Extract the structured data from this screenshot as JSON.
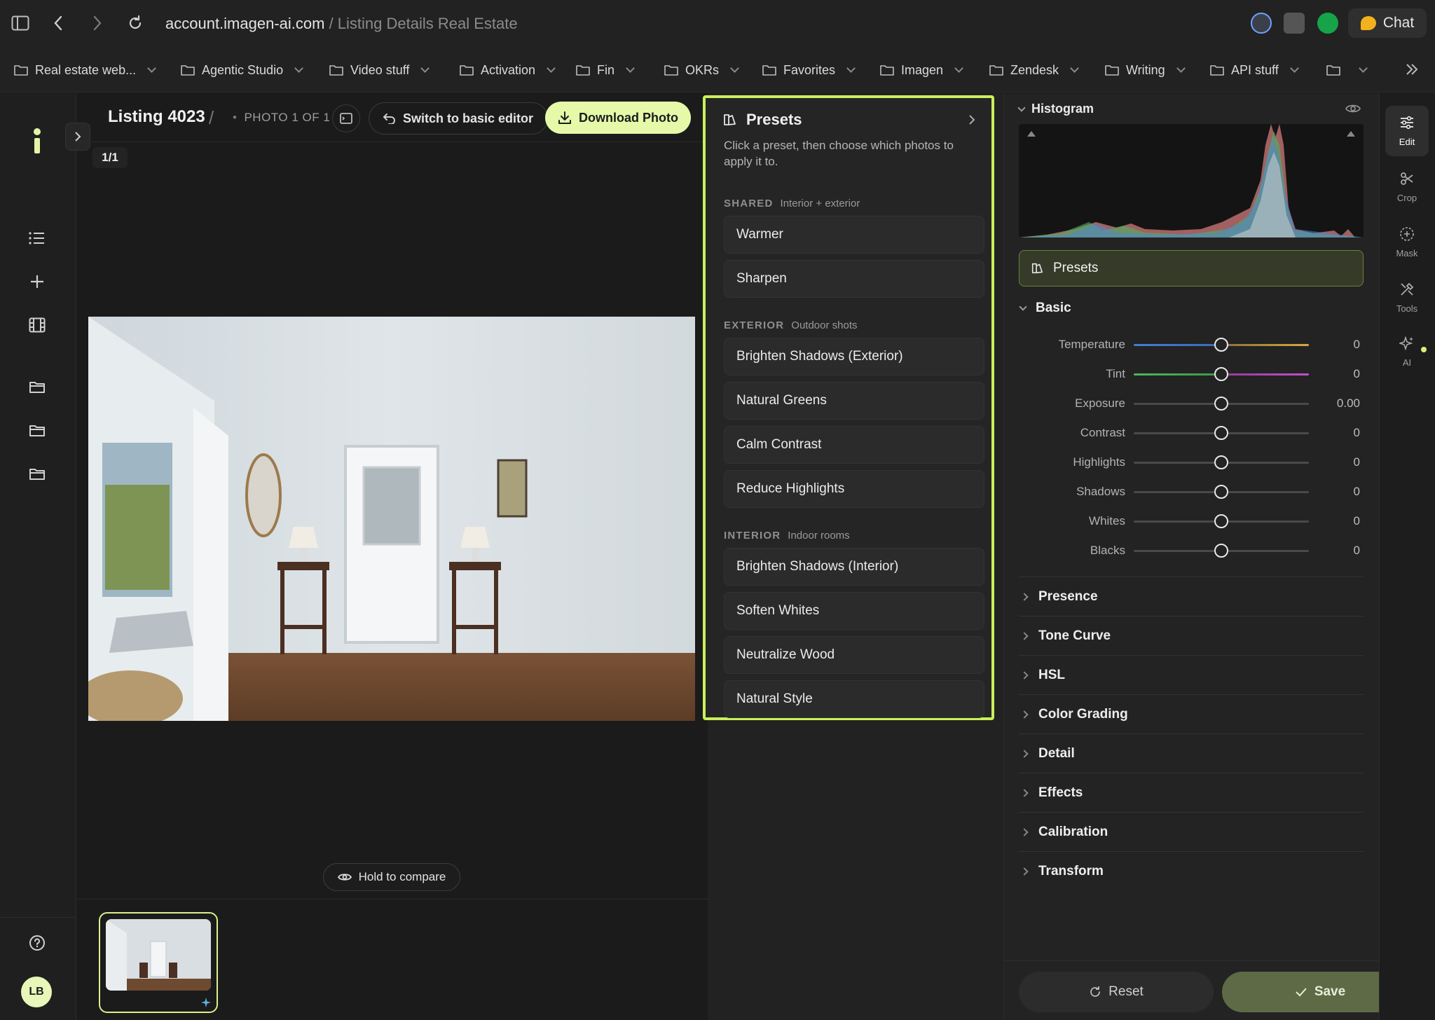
{
  "browser": {
    "url_host": "account.imagen-ai.com",
    "url_path": " / Listing Details Real Estate",
    "chat_label": "Chat",
    "bookmarks": [
      {
        "label": "Real estate web..."
      },
      {
        "label": "Agentic Studio"
      },
      {
        "label": "Video stuff"
      },
      {
        "label": "Activation"
      },
      {
        "label": "Fin"
      },
      {
        "label": "OKRs"
      },
      {
        "label": "Favorites"
      },
      {
        "label": "Imagen"
      },
      {
        "label": "Zendesk"
      },
      {
        "label": "Writing"
      },
      {
        "label": "API stuff"
      },
      {
        "label": ""
      }
    ]
  },
  "sidebar": {
    "avatar_initials": "LB",
    "icons": [
      "logo-icon",
      "list-icon",
      "plus-icon",
      "film-icon",
      "folder-icon",
      "folder-icon",
      "folder-icon",
      "help-icon"
    ]
  },
  "editor": {
    "title": "Listing 4023",
    "separator": "/",
    "photo_counter_text": "PHOTO 1 OF 1",
    "switch_label": "Switch to basic editor",
    "download_label": "Download Photo",
    "page_counter": "1/1",
    "compare_label": "Hold to compare"
  },
  "presets": {
    "title": "Presets",
    "description": "Click a preset, then choose which photos to apply it to.",
    "sections": [
      {
        "name": "SHARED",
        "subtitle": "Interior + exterior",
        "items": [
          "Warmer",
          "Sharpen"
        ]
      },
      {
        "name": "EXTERIOR",
        "subtitle": "Outdoor shots",
        "items": [
          "Brighten Shadows (Exterior)",
          "Natural Greens",
          "Calm Contrast",
          "Reduce Highlights"
        ]
      },
      {
        "name": "INTERIOR",
        "subtitle": "Indoor rooms",
        "items": [
          "Brighten Shadows (Interior)",
          "Soften Whites",
          "Neutralize Wood",
          "Natural Style"
        ]
      }
    ]
  },
  "edit_panel": {
    "histogram_title": "Histogram",
    "presets_button": "Presets",
    "basic_title": "Basic",
    "sliders": [
      {
        "label": "Temperature",
        "value": "0",
        "position": 0.5
      },
      {
        "label": "Tint",
        "value": "0",
        "position": 0.5
      },
      {
        "label": "Exposure",
        "value": "0.00",
        "position": 0.5
      },
      {
        "label": "Contrast",
        "value": "0",
        "position": 0.5
      },
      {
        "label": "Highlights",
        "value": "0",
        "position": 0.5
      },
      {
        "label": "Shadows",
        "value": "0",
        "position": 0.5
      },
      {
        "label": "Whites",
        "value": "0",
        "position": 0.5
      },
      {
        "label": "Blacks",
        "value": "0",
        "position": 0.5
      }
    ],
    "sections": [
      "Presence",
      "Tone Curve",
      "HSL",
      "Color Grading",
      "Detail",
      "Effects",
      "Calibration",
      "Transform"
    ],
    "reset_label": "Reset",
    "save_label": "Save"
  },
  "tool_rail": {
    "tools": [
      {
        "label": "Edit",
        "icon": "sliders-icon",
        "active": true
      },
      {
        "label": "Crop",
        "icon": "crop-icon",
        "active": false
      },
      {
        "label": "Mask",
        "icon": "mask-icon",
        "active": false
      },
      {
        "label": "Tools",
        "icon": "tools-icon",
        "active": false
      },
      {
        "label": "AI",
        "icon": "sparkle-icon",
        "active": false
      }
    ]
  },
  "colors": {
    "accent_green": "#c8f05a",
    "download_bg": "#e6f9a8",
    "save_bg": "#5e6a46",
    "temperature_cold": "#3f7fd8",
    "temperature_warm": "#d6a93a",
    "tint_green": "#4bb85a",
    "tint_magenta": "#c34fc8"
  }
}
